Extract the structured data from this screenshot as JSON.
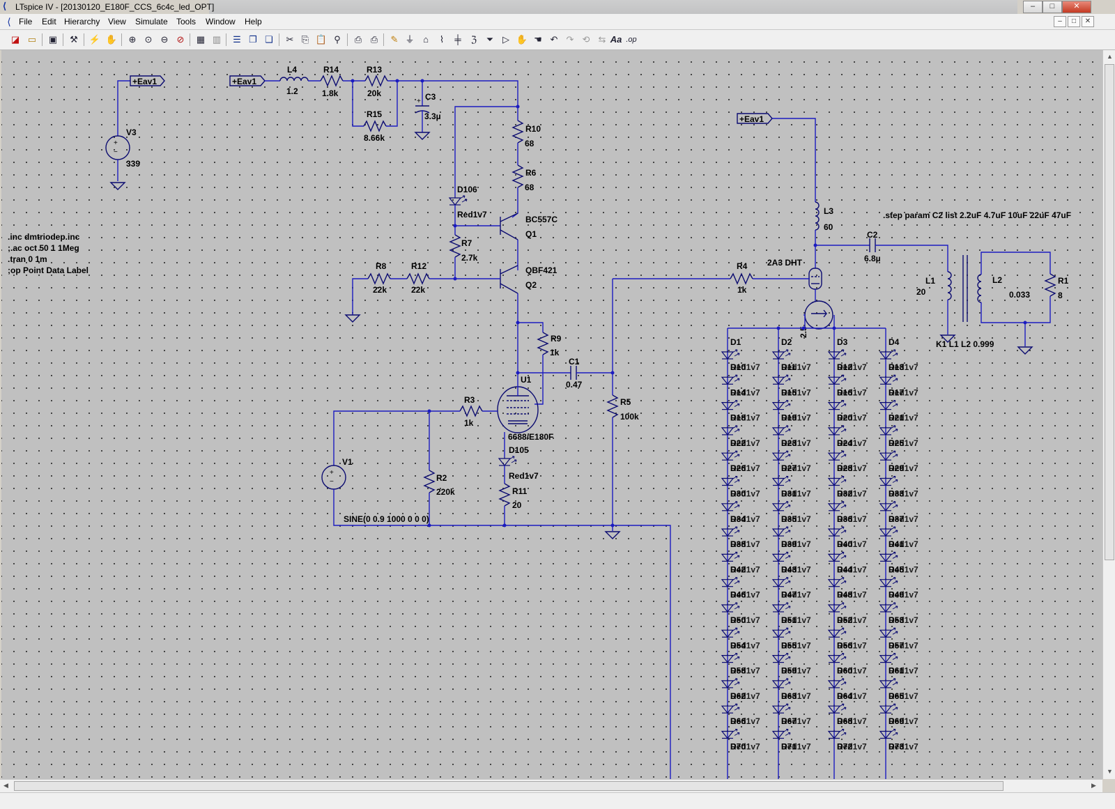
{
  "window": {
    "title": "LTspice IV - [20130120_E180F_CCS_6c4c_led_OPT]",
    "minimize": "–",
    "maximize": "□",
    "close": "✕"
  },
  "menu": [
    "File",
    "Edit",
    "Hierarchy",
    "View",
    "Simulate",
    "Tools",
    "Window",
    "Help"
  ],
  "toolbar": {
    "icons": [
      "new-schematic-icon",
      "open-icon",
      "save-icon",
      "control-panel-icon",
      "run-icon",
      "pan-icon",
      "zoom-in-icon",
      "zoom-fit-icon",
      "zoom-out-icon",
      "zoom-cancel-icon",
      "autorange-icon",
      "fit-plot-icon",
      "tile-horizontal-icon",
      "cascade-icon",
      "close-all-icon",
      "cut-icon",
      "copy-icon",
      "paste-icon",
      "find-icon",
      "print-setup-icon",
      "print-icon",
      "draw-wire-icon",
      "ground-icon",
      "label-net-icon",
      "resistor-icon",
      "capacitor-icon",
      "inductor-icon",
      "diode-icon",
      "component-icon",
      "move-icon",
      "drag-icon",
      "undo-icon",
      "redo-icon",
      "rotate-icon",
      "mirror-icon",
      "text-icon",
      "spice-directive-icon"
    ],
    "text_label": "Aa",
    "op_label": ".op"
  },
  "schematic": {
    "net_label": "+Eav1",
    "components": {
      "V3": {
        "name": "V3",
        "value": "339"
      },
      "L4": {
        "name": "L4",
        "value": "1.2"
      },
      "R14": {
        "name": "R14",
        "value": "1.8k"
      },
      "R13": {
        "name": "R13",
        "value": "20k"
      },
      "R15": {
        "name": "R15",
        "value": "8.66k"
      },
      "C3": {
        "name": "C3",
        "value": "3.3µ"
      },
      "R10": {
        "name": "R10",
        "value": "68"
      },
      "R6": {
        "name": "R6",
        "value": "68"
      },
      "D106": {
        "name": "D106",
        "value": "Red1v7"
      },
      "Q1": {
        "name": "Q1",
        "value": "BC557C"
      },
      "Q2": {
        "name": "Q2",
        "value": "QBF421"
      },
      "R7": {
        "name": "R7",
        "value": "2.7k"
      },
      "R8": {
        "name": "R8",
        "value": "22k"
      },
      "R12": {
        "name": "R12",
        "value": "22k"
      },
      "R9": {
        "name": "R9",
        "value": "1k"
      },
      "C1": {
        "name": "C1",
        "value": "0.47"
      },
      "U1": {
        "name": "U1",
        "value": "6688/E180F"
      },
      "R3": {
        "name": "R3",
        "value": "1k"
      },
      "R5": {
        "name": "R5",
        "value": "100k"
      },
      "V1": {
        "name": "V1",
        "value": "SINE(0 0.9 1000 0 0 0)"
      },
      "R2": {
        "name": "R2",
        "value": "220k"
      },
      "D105": {
        "name": "D105",
        "value": "Red1v7"
      },
      "R11": {
        "name": "R11",
        "value": "20"
      },
      "L3": {
        "name": "L3",
        "value": "60"
      },
      "C2": {
        "name": "C2",
        "value": "6.8µ"
      },
      "R4": {
        "name": "R4",
        "value": "1k"
      },
      "tube": {
        "name": "2A3 DHT",
        "value": "2.5"
      },
      "L1": {
        "name": "L1",
        "value": "20"
      },
      "L2": {
        "name": "L2",
        "value": "0.033"
      },
      "R1": {
        "name": "R1",
        "value": "8"
      }
    },
    "directives": {
      "inc": ".inc dmtriodep.inc",
      "ac": ";.ac oct 50 1 1Meg",
      "tran": ".tran 0 1m",
      "op": ";op Point Data Label",
      "step": ".step param C2 list 2.2uF 4.7uF 10uF 22uF 47uF",
      "coupling": "K1 L1 L2 0.999"
    },
    "led_string": {
      "headers": [
        "D1",
        "D2",
        "D3",
        "D4"
      ],
      "value": "Red1v7",
      "rows": [
        [
          "D10",
          "D11",
          "D12",
          "D13"
        ],
        [
          "D14",
          "D15",
          "D16",
          "D17"
        ],
        [
          "D18",
          "D19",
          "D20",
          "D21"
        ],
        [
          "D22",
          "D23",
          "D24",
          "D25"
        ],
        [
          "D26",
          "D27",
          "D28",
          "D29"
        ],
        [
          "D30",
          "D31",
          "D32",
          "D33"
        ],
        [
          "D34",
          "D35",
          "D36",
          "D37"
        ],
        [
          "D38",
          "D39",
          "D40",
          "D41"
        ],
        [
          "D42",
          "D43",
          "D44",
          "D45"
        ],
        [
          "D46",
          "D47",
          "D48",
          "D49"
        ],
        [
          "D50",
          "D51",
          "D52",
          "D53"
        ],
        [
          "D54",
          "D55",
          "D56",
          "D57"
        ],
        [
          "D58",
          "D59",
          "D60",
          "D61"
        ],
        [
          "D62",
          "D63",
          "D64",
          "D65"
        ],
        [
          "D66",
          "D67",
          "D68",
          "D69"
        ],
        [
          "D70",
          "D71",
          "D72",
          "D73"
        ]
      ]
    }
  }
}
